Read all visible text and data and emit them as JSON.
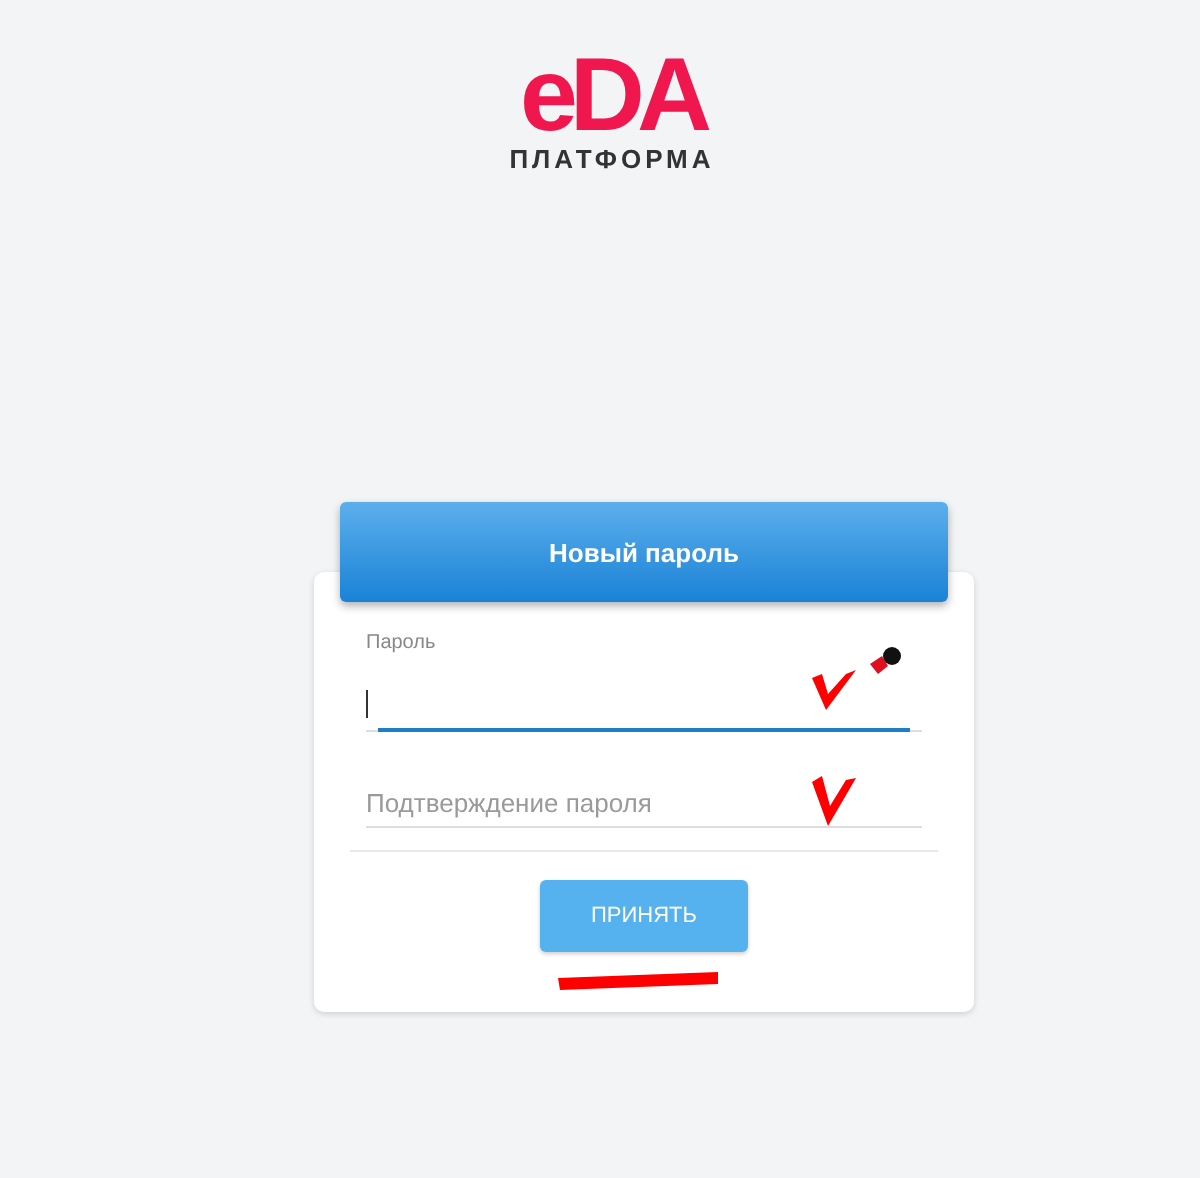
{
  "logo": {
    "mark": "eDA",
    "subtitle": "ПЛАТФОРМА"
  },
  "card": {
    "title": "Новый пароль",
    "fields": [
      {
        "label": "Пароль",
        "focused": true
      },
      {
        "placeholder": "Подтверждение пароля",
        "focused": false
      }
    ],
    "submit": "ПРИНЯТЬ"
  }
}
